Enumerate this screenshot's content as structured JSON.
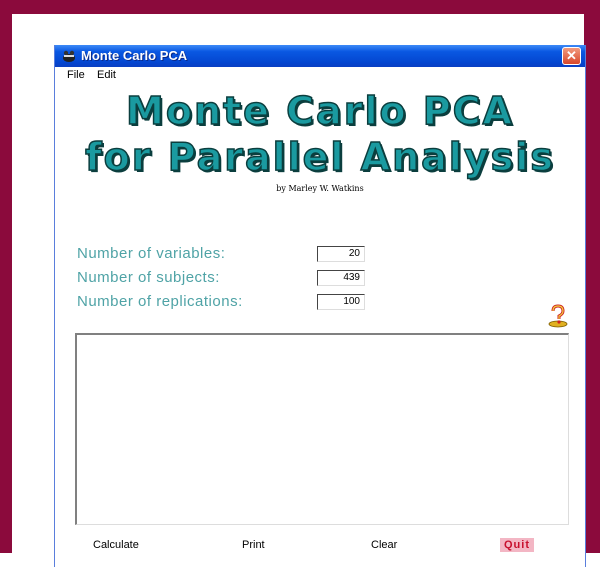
{
  "window": {
    "title": "Monte Carlo PCA",
    "close_glyph": "✕"
  },
  "menu": {
    "items": [
      "File",
      "Edit"
    ]
  },
  "header": {
    "title_line1": "Monte Carlo PCA",
    "title_line2": "for Parallel Analysis",
    "author": "by Marley W. Watkins"
  },
  "fields": [
    {
      "label": "Number of variables:",
      "value": "20"
    },
    {
      "label": "Number of subjects:",
      "value": "439"
    },
    {
      "label": "Number of replications:",
      "value": "100"
    }
  ],
  "output": {
    "text": ""
  },
  "buttons": {
    "calculate": "Calculate",
    "print": "Print",
    "clear": "Clear",
    "quit": "Quit"
  },
  "icons": {
    "app": "app-icon",
    "help": "help-icon",
    "close": "close-icon"
  },
  "colors": {
    "frame": "#8b0a3c",
    "title_teal": "#1a9aa0",
    "label_teal": "#4fa3a6",
    "quit_bg": "#f3b6c4",
    "quit_text": "#c8102e"
  }
}
